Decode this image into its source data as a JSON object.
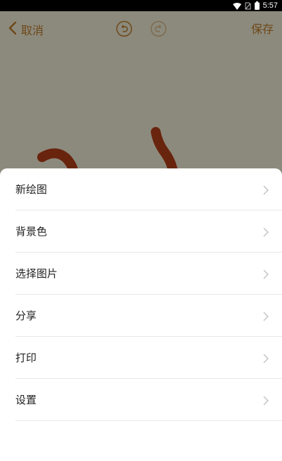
{
  "status_bar": {
    "time": "5:57",
    "icons": [
      "wifi-icon",
      "no-sim-icon",
      "battery-icon"
    ]
  },
  "toolbar": {
    "cancel_label": "取消",
    "save_label": "保存",
    "undo_icon": "undo-icon",
    "redo_icon": "redo-icon"
  },
  "menu": {
    "items": [
      {
        "label": "新绘图",
        "icon": "chevron-right-icon"
      },
      {
        "label": "背景色",
        "icon": "chevron-right-icon"
      },
      {
        "label": "选择图片",
        "icon": "chevron-right-icon"
      },
      {
        "label": "分享",
        "icon": "chevron-right-icon"
      },
      {
        "label": "打印",
        "icon": "chevron-right-icon"
      },
      {
        "label": "设置",
        "icon": "chevron-right-icon"
      }
    ]
  },
  "colors": {
    "accent": "#c7842a",
    "canvas_background": "#fffbe3",
    "stroke": "#c0431a",
    "overlay": "rgba(0,0,0,0.45)"
  }
}
